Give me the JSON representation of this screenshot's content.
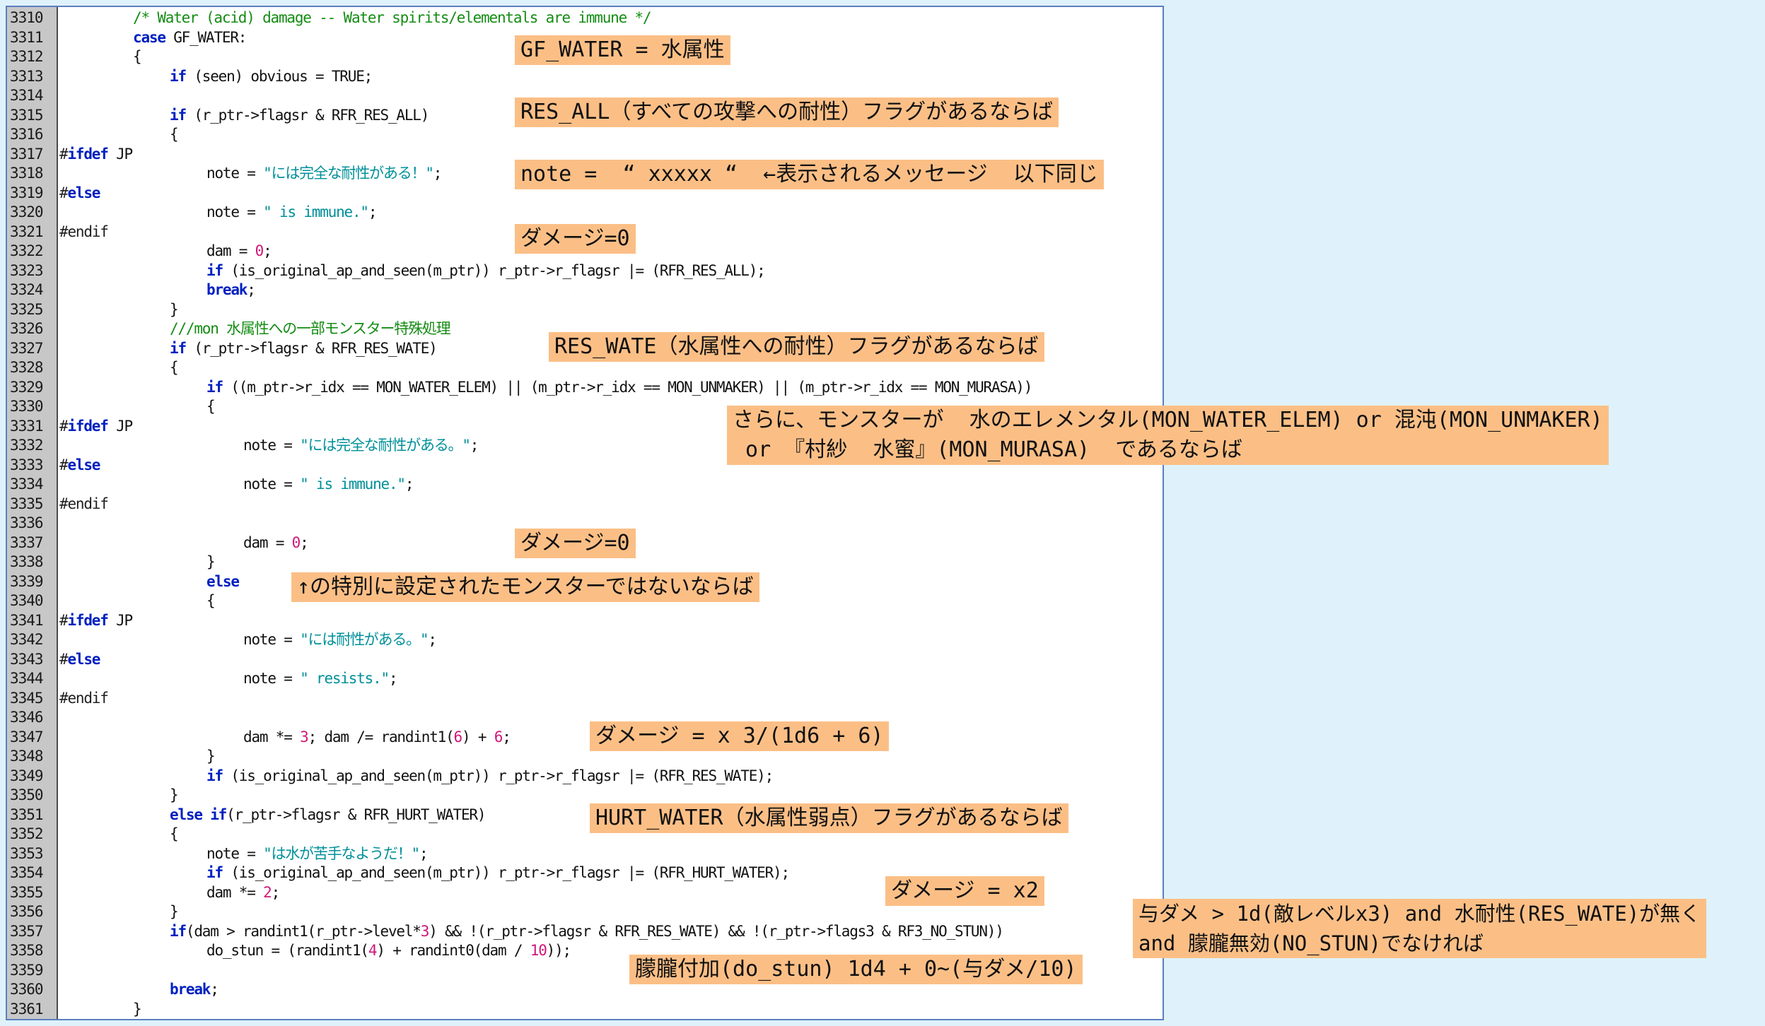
{
  "code_lines": [
    {
      "n": "3310",
      "segs": [
        [
          "/* Water (acid) damage -- Water spirits/elementals are immune */",
          "cm"
        ]
      ],
      "indent": 2
    },
    {
      "n": "3311",
      "segs": [
        [
          "case",
          "kw"
        ],
        [
          " GF_WATER:",
          ""
        ]
      ],
      "indent": 2
    },
    {
      "n": "3312",
      "segs": [
        [
          "{",
          ""
        ]
      ],
      "indent": 2
    },
    {
      "n": "3313",
      "segs": [
        [
          "if",
          "kw"
        ],
        [
          " (seen) obvious = TRUE;",
          ""
        ]
      ],
      "indent": 3
    },
    {
      "n": "3314",
      "segs": [],
      "indent": 0
    },
    {
      "n": "3315",
      "segs": [
        [
          "if",
          "kw"
        ],
        [
          " (r_ptr->flagsr & RFR_RES_ALL)",
          ""
        ]
      ],
      "indent": 3
    },
    {
      "n": "3316",
      "segs": [
        [
          "{",
          ""
        ]
      ],
      "indent": 3
    },
    {
      "n": "3317",
      "segs": [
        [
          "#",
          "pp"
        ],
        [
          "ifdef",
          "kw"
        ],
        [
          " JP",
          ""
        ]
      ],
      "indent": 0
    },
    {
      "n": "3318",
      "segs": [
        [
          "note = ",
          ""
        ],
        [
          "\"には完全な耐性がある！\"",
          "st"
        ],
        [
          ";",
          ""
        ]
      ],
      "indent": 4
    },
    {
      "n": "3319",
      "segs": [
        [
          "#",
          "pp"
        ],
        [
          "else",
          "kw"
        ]
      ],
      "indent": 0
    },
    {
      "n": "3320",
      "segs": [
        [
          "note = ",
          ""
        ],
        [
          "\" is immune.\"",
          "st"
        ],
        [
          ";",
          ""
        ]
      ],
      "indent": 4
    },
    {
      "n": "3321",
      "segs": [
        [
          "#endif",
          "pp"
        ]
      ],
      "indent": 0
    },
    {
      "n": "3322",
      "segs": [
        [
          "dam = ",
          ""
        ],
        [
          "0",
          "nm"
        ],
        [
          ";",
          ""
        ]
      ],
      "indent": 4
    },
    {
      "n": "3323",
      "segs": [
        [
          "if",
          "kw"
        ],
        [
          " (is_original_ap_and_seen(m_ptr)) r_ptr->r_flagsr |= (RFR_RES_ALL);",
          ""
        ]
      ],
      "indent": 4
    },
    {
      "n": "3324",
      "segs": [
        [
          "break",
          "kw"
        ],
        [
          ";",
          ""
        ]
      ],
      "indent": 4
    },
    {
      "n": "3325",
      "segs": [
        [
          "}",
          ""
        ]
      ],
      "indent": 3
    },
    {
      "n": "3326",
      "segs": [
        [
          "///mon 水属性への一部モンスター特殊処理",
          "cm"
        ]
      ],
      "indent": 3
    },
    {
      "n": "3327",
      "segs": [
        [
          "if",
          "kw"
        ],
        [
          " (r_ptr->flagsr & RFR_RES_WATE)",
          ""
        ]
      ],
      "indent": 3
    },
    {
      "n": "3328",
      "segs": [
        [
          "{",
          ""
        ]
      ],
      "indent": 3
    },
    {
      "n": "3329",
      "segs": [
        [
          "if",
          "kw"
        ],
        [
          " ((m_ptr->r_idx == MON_WATER_ELEM) || (m_ptr->r_idx == MON_UNMAKER) || (m_ptr->r_idx == MON_MURASA))",
          ""
        ]
      ],
      "indent": 4
    },
    {
      "n": "3330",
      "segs": [
        [
          "{",
          ""
        ]
      ],
      "indent": 4
    },
    {
      "n": "3331",
      "segs": [
        [
          "#",
          "pp"
        ],
        [
          "ifdef",
          "kw"
        ],
        [
          " JP",
          ""
        ]
      ],
      "indent": 0
    },
    {
      "n": "3332",
      "segs": [
        [
          "note = ",
          ""
        ],
        [
          "\"には完全な耐性がある。\"",
          "st"
        ],
        [
          ";",
          ""
        ]
      ],
      "indent": 5
    },
    {
      "n": "3333",
      "segs": [
        [
          "#",
          "pp"
        ],
        [
          "else",
          "kw"
        ]
      ],
      "indent": 0
    },
    {
      "n": "3334",
      "segs": [
        [
          "note = ",
          ""
        ],
        [
          "\" is immune.\"",
          "st"
        ],
        [
          ";",
          ""
        ]
      ],
      "indent": 5
    },
    {
      "n": "3335",
      "segs": [
        [
          "#endif",
          "pp"
        ]
      ],
      "indent": 0
    },
    {
      "n": "3336",
      "segs": [],
      "indent": 0
    },
    {
      "n": "3337",
      "segs": [
        [
          "dam = ",
          ""
        ],
        [
          "0",
          "nm"
        ],
        [
          ";",
          ""
        ]
      ],
      "indent": 5
    },
    {
      "n": "3338",
      "segs": [
        [
          "}",
          ""
        ]
      ],
      "indent": 4
    },
    {
      "n": "3339",
      "segs": [
        [
          "else",
          "kw"
        ]
      ],
      "indent": 4
    },
    {
      "n": "3340",
      "segs": [
        [
          "{",
          ""
        ]
      ],
      "indent": 4
    },
    {
      "n": "3341",
      "segs": [
        [
          "#",
          "pp"
        ],
        [
          "ifdef",
          "kw"
        ],
        [
          " JP",
          ""
        ]
      ],
      "indent": 0
    },
    {
      "n": "3342",
      "segs": [
        [
          "note = ",
          ""
        ],
        [
          "\"には耐性がある。\"",
          "st"
        ],
        [
          ";",
          ""
        ]
      ],
      "indent": 5
    },
    {
      "n": "3343",
      "segs": [
        [
          "#",
          "pp"
        ],
        [
          "else",
          "kw"
        ]
      ],
      "indent": 0
    },
    {
      "n": "3344",
      "segs": [
        [
          "note = ",
          ""
        ],
        [
          "\" resists.\"",
          "st"
        ],
        [
          ";",
          ""
        ]
      ],
      "indent": 5
    },
    {
      "n": "3345",
      "segs": [
        [
          "#endif",
          "pp"
        ]
      ],
      "indent": 0
    },
    {
      "n": "3346",
      "segs": [],
      "indent": 0
    },
    {
      "n": "3347",
      "segs": [
        [
          "dam *= ",
          ""
        ],
        [
          "3",
          "nm"
        ],
        [
          "; dam /= randint1(",
          ""
        ],
        [
          "6",
          "nm"
        ],
        [
          ") + ",
          ""
        ],
        [
          "6",
          "nm"
        ],
        [
          ";",
          ""
        ]
      ],
      "indent": 5
    },
    {
      "n": "3348",
      "segs": [
        [
          "}",
          ""
        ]
      ],
      "indent": 4
    },
    {
      "n": "3349",
      "segs": [
        [
          "if",
          "kw"
        ],
        [
          " (is_original_ap_and_seen(m_ptr)) r_ptr->r_flagsr |= (RFR_RES_WATE);",
          ""
        ]
      ],
      "indent": 4
    },
    {
      "n": "3350",
      "segs": [
        [
          "}",
          ""
        ]
      ],
      "indent": 3
    },
    {
      "n": "3351",
      "segs": [
        [
          "else if",
          "kw"
        ],
        [
          "(r_ptr->flagsr & RFR_HURT_WATER)",
          ""
        ]
      ],
      "indent": 3
    },
    {
      "n": "3352",
      "segs": [
        [
          "{",
          ""
        ]
      ],
      "indent": 3
    },
    {
      "n": "3353",
      "segs": [
        [
          "note = ",
          ""
        ],
        [
          "\"は水が苦手なようだ！\"",
          "st"
        ],
        [
          ";",
          ""
        ]
      ],
      "indent": 4
    },
    {
      "n": "3354",
      "segs": [
        [
          "if",
          "kw"
        ],
        [
          " (is_original_ap_and_seen(m_ptr)) r_ptr->r_flagsr |= (RFR_HURT_WATER);",
          ""
        ]
      ],
      "indent": 4
    },
    {
      "n": "3355",
      "segs": [
        [
          "dam *= ",
          ""
        ],
        [
          "2",
          "nm"
        ],
        [
          ";",
          ""
        ]
      ],
      "indent": 4
    },
    {
      "n": "3356",
      "segs": [
        [
          "}",
          ""
        ]
      ],
      "indent": 3
    },
    {
      "n": "3357",
      "segs": [
        [
          "if",
          "kw"
        ],
        [
          "(dam > randint1(r_ptr->level*",
          ""
        ],
        [
          "3",
          "nm"
        ],
        [
          ") && !(r_ptr->flagsr & RFR_RES_WATE) && !(r_ptr->flags3 & RF3_NO_STUN))",
          ""
        ]
      ],
      "indent": 3
    },
    {
      "n": "3358",
      "segs": [
        [
          "do_stun = (randint1(",
          ""
        ],
        [
          "4",
          "nm"
        ],
        [
          ") + randint0(dam / ",
          ""
        ],
        [
          "10",
          "nm"
        ],
        [
          "));",
          ""
        ]
      ],
      "indent": 4
    },
    {
      "n": "3359",
      "segs": [],
      "indent": 0
    },
    {
      "n": "3360",
      "segs": [
        [
          "break",
          "kw"
        ],
        [
          ";",
          ""
        ]
      ],
      "indent": 3
    },
    {
      "n": "3361",
      "segs": [
        [
          "}",
          ""
        ]
      ],
      "indent": 2
    }
  ],
  "annotations": [
    {
      "id": "gf-water",
      "text": "GF_WATER = 水属性"
    },
    {
      "id": "res-all",
      "text": "RES_ALL（すべての攻撃への耐性）フラグがあるならば"
    },
    {
      "id": "note-msg",
      "text": "note =  “ xxxxx “  ←表示されるメッセージ  以下同じ"
    },
    {
      "id": "dmg-zero-1",
      "text": "ダメージ=0"
    },
    {
      "id": "res-wate",
      "text": "RES_WATE（水属性への耐性）フラグがあるならば"
    },
    {
      "id": "special-mon",
      "text": "さらに、モンスターが  水のエレメンタル(MON_WATER_ELEM) or 混沌(MON_UNMAKER)\n or 『村紗  水蜜』(MON_MURASA)  であるならば"
    },
    {
      "id": "dmg-zero-2",
      "text": "ダメージ=0"
    },
    {
      "id": "not-special",
      "text": "↑の特別に設定されたモンスターではないならば"
    },
    {
      "id": "dmg-formula",
      "text": "ダメージ = x 3/(1d6 + 6)"
    },
    {
      "id": "hurt-water",
      "text": "HURT_WATER（水属性弱点）フラグがあるならば"
    },
    {
      "id": "dmg-x2",
      "text": "ダメージ = x2"
    },
    {
      "id": "stun-cond",
      "text": "与ダメ > 1d(敵レベルx3) and 水耐性(RES_WATE)が無く\nand 朦朧無効(NO_STUN)でなければ"
    },
    {
      "id": "stun-add",
      "text": "朦朧付加(do_stun) 1d4 + 0~(与ダメ/10)"
    }
  ],
  "colors": {
    "background": "#dff2fb",
    "editor_border": "#5b7fc0",
    "gutter": "#c7c7c7",
    "note_bg": "#fbbf86",
    "keyword": "#0020c0",
    "comment": "#148c14",
    "string": "#00909a",
    "number": "#d0167a"
  }
}
